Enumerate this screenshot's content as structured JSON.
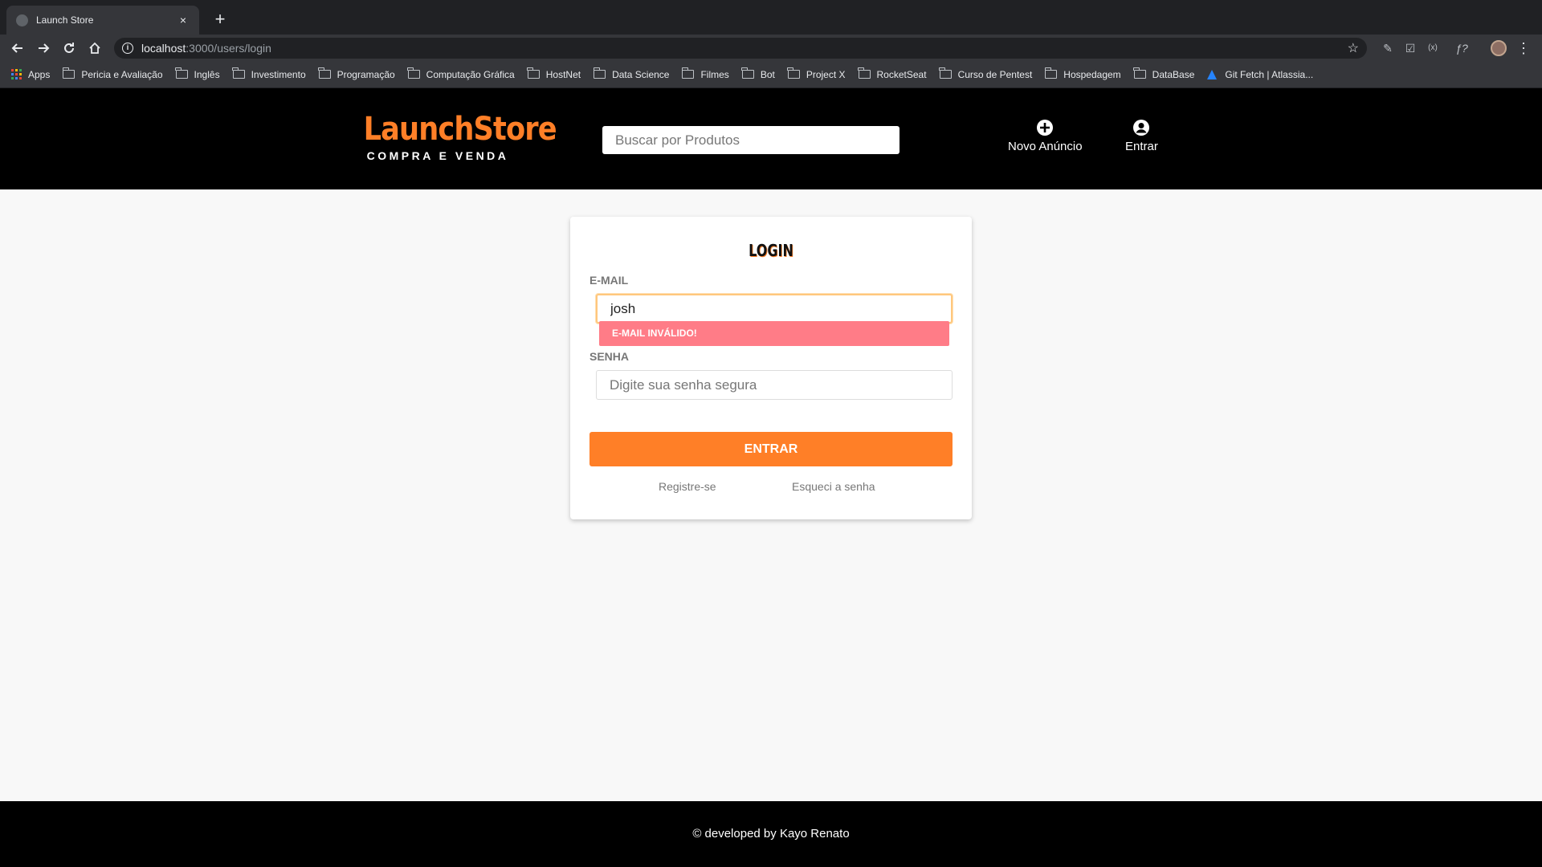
{
  "browser": {
    "tab_title": "Launch Store",
    "tab_close": "×",
    "new_tab": "+",
    "url_host": "localhost",
    "url_path": ":3000/users/login",
    "bookmarks": [
      {
        "label": "Apps",
        "icon": "apps-icon"
      },
      {
        "label": "Pericia e Avaliação",
        "icon": "folder-icon"
      },
      {
        "label": "Inglês",
        "icon": "folder-icon"
      },
      {
        "label": "Investimento",
        "icon": "folder-icon"
      },
      {
        "label": "Programação",
        "icon": "folder-icon"
      },
      {
        "label": "Computação Gráfica",
        "icon": "folder-icon"
      },
      {
        "label": "HostNet",
        "icon": "folder-icon"
      },
      {
        "label": "Data Science",
        "icon": "folder-icon"
      },
      {
        "label": "Filmes",
        "icon": "folder-icon"
      },
      {
        "label": "Bot",
        "icon": "folder-icon"
      },
      {
        "label": "Project X",
        "icon": "folder-icon"
      },
      {
        "label": "RocketSeat",
        "icon": "folder-icon"
      },
      {
        "label": "Curso de Pentest",
        "icon": "folder-icon"
      },
      {
        "label": "Hospedagem",
        "icon": "folder-icon"
      },
      {
        "label": "DataBase",
        "icon": "folder-icon"
      },
      {
        "label": "Git Fetch | Atlassia...",
        "icon": "atlassian-icon"
      }
    ]
  },
  "header": {
    "logo_title": "LaunchStore",
    "logo_subtitle": "COMPRA E VENDA",
    "search_placeholder": "Buscar por Produtos",
    "new_ad_label": "Novo Anúncio",
    "login_label": "Entrar"
  },
  "login": {
    "title": "LOGIN",
    "email_label": "E-MAIL",
    "email_value": "josh",
    "email_error": "E-MAIL INVÁLIDO!",
    "password_label": "SENHA",
    "password_placeholder": "Digite sua senha segura",
    "submit_label": "ENTRAR",
    "register_link": "Registre-se",
    "forgot_link": "Esqueci a senha"
  },
  "footer": {
    "credit": "© developed by Kayo Renato"
  },
  "colors": {
    "brand_orange": "#ff7f27",
    "error_pink": "#ff7c87",
    "header_bg": "#000000",
    "page_bg": "#f8f8f8"
  }
}
